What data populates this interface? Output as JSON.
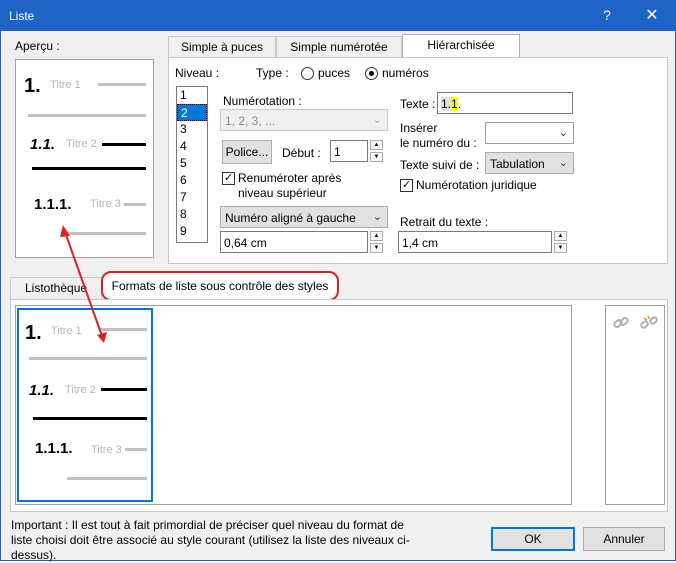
{
  "window": {
    "title": "Liste",
    "help": "?",
    "close": "✕"
  },
  "preview": {
    "label": "Aperçu :",
    "levels": [
      {
        "num": "1.",
        "title": "Titre 1"
      },
      {
        "num": "1.1.",
        "title": "Titre 2"
      },
      {
        "num": "1.1.1.",
        "title": "Titre 3"
      }
    ]
  },
  "tabs": [
    "Simple à puces",
    "Simple numérotée",
    "Hiérarchisée"
  ],
  "level": {
    "label": "Niveau :",
    "items": [
      "1",
      "2",
      "3",
      "4",
      "5",
      "6",
      "7",
      "8",
      "9"
    ],
    "selected": "2"
  },
  "type": {
    "label": "Type :",
    "options": [
      "puces",
      "numéros"
    ],
    "selected": "numéros"
  },
  "numerotation": {
    "label": "Numérotation :",
    "value": "1, 2, 3, ..."
  },
  "police_button": "Police...",
  "debut": {
    "label": "Début :",
    "value": "1"
  },
  "renumeroter": {
    "label_line1": "Renuméroter après",
    "label_line2": "niveau supérieur",
    "checked": true
  },
  "alignment": {
    "value": "Numéro aligné à gauche"
  },
  "align_value": "0,64 cm",
  "texte": {
    "label": "Texte :",
    "value_prefix": "1.",
    "value_highlight": "1",
    "value_suffix": "."
  },
  "inserer": {
    "label_line1": "Insérer",
    "label_line2": "le numéro du :",
    "value": ""
  },
  "texte_suivi": {
    "label": "Texte suivi de :",
    "value": "Tabulation"
  },
  "numerotation_juridique": {
    "label": "Numérotation juridique",
    "checked": true
  },
  "retrait": {
    "label": "Retrait du texte :",
    "value": "1,4 cm"
  },
  "lower_tabs": [
    "Listothèque",
    "Formats de liste sous contrôle des styles"
  ],
  "gallery": {
    "levels": [
      {
        "num": "1.",
        "title": "Titre 1"
      },
      {
        "num": "1.1.",
        "title": "Titre 2"
      },
      {
        "num": "1.1.1.",
        "title": "Titre 3"
      }
    ]
  },
  "important": "Important : Il est tout à fait primordial de préciser quel niveau du format de liste choisi doit être associé au style courant (utilisez la liste des niveaux ci-dessus).",
  "ok": "OK",
  "cancel": "Annuler",
  "colors": {
    "accent": "#0078d7",
    "titlebar": "#1f63c6",
    "annotation": "#e02020"
  }
}
